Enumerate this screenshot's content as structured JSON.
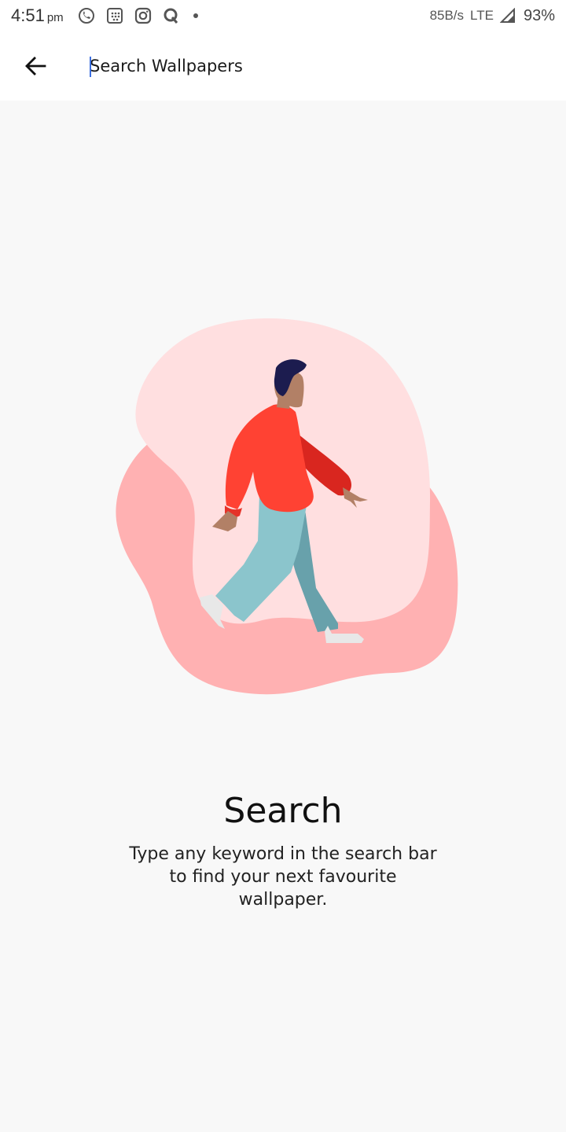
{
  "status_bar": {
    "time": "4:51",
    "ampm": "pm",
    "notification_icons": [
      "whatsapp-icon",
      "calendar-grid-icon",
      "instagram-icon",
      "quora-icon",
      "dot-icon"
    ],
    "net_speed": "85B/s",
    "net_type": "LTE",
    "battery": "93%"
  },
  "app_bar": {
    "back_icon": "arrow-left-icon",
    "search_placeholder": "Search Wallpapers",
    "search_value": ""
  },
  "empty_state": {
    "illustration": "walking-person-illustration",
    "title": "Search",
    "description": "Type any keyword in the search bar to find your next favourite wallpaper."
  },
  "colors": {
    "background": "#f8f8f8",
    "blob_light": "#ffdfe0",
    "blob_dark": "#ffb1b2",
    "sweater": "#ff4233",
    "pants": "#8bc5cc",
    "caret": "#3b6fe0"
  }
}
